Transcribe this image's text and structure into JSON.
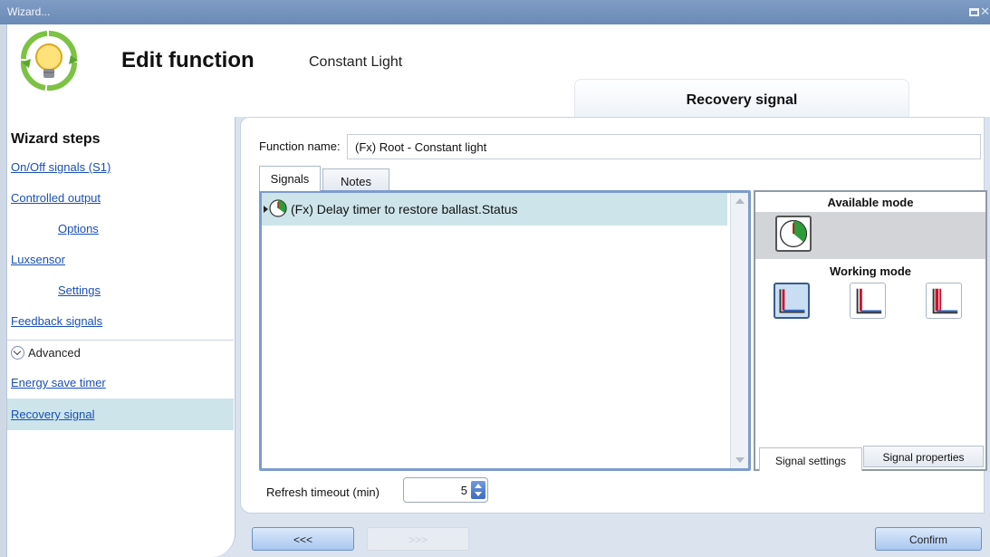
{
  "window": {
    "title": "Wizard..."
  },
  "header": {
    "title": "Edit function",
    "subtitle": "Constant Light",
    "current_step_tab": "Recovery signal"
  },
  "sidebar": {
    "title": "Wizard steps",
    "items": [
      {
        "label": "On/Off signals (S1)"
      },
      {
        "label": "Controlled output"
      },
      {
        "label": "Options"
      },
      {
        "label": "Luxsensor"
      },
      {
        "label": "Settings"
      },
      {
        "label": "Feedback signals"
      }
    ],
    "advanced_label": "Advanced",
    "advanced_items": [
      {
        "label": "Energy save timer"
      },
      {
        "label": "Recovery signal",
        "selected": true
      }
    ]
  },
  "main": {
    "function_name_label": "Function name:",
    "function_name_value": "(Fx) Root - Constant light",
    "tabs": [
      {
        "label": "Signals",
        "active": true
      },
      {
        "label": "Notes"
      }
    ],
    "signals": [
      {
        "label": "(Fx) Delay timer to restore ballast.Status",
        "icon": "timer-clock-icon"
      }
    ],
    "available_mode_label": "Available mode",
    "working_mode_label": "Working mode",
    "working_modes": [
      "level-mode-icon",
      "rising-edge-mode-icon",
      "falling-edge-mode-icon"
    ],
    "panel_tabs": [
      {
        "label": "Signal settings",
        "active": true
      },
      {
        "label": "Signal properties"
      }
    ],
    "refresh_label": "Refresh timeout (min)",
    "refresh_value": "5"
  },
  "footer": {
    "back_label": "<<<",
    "next_label": ">>>",
    "confirm_label": "Confirm"
  },
  "colors": {
    "title_bar": "#6f8fba",
    "selection": "#cde5ea",
    "link": "#1a4fb5",
    "list_border": "#7d9ccc"
  }
}
